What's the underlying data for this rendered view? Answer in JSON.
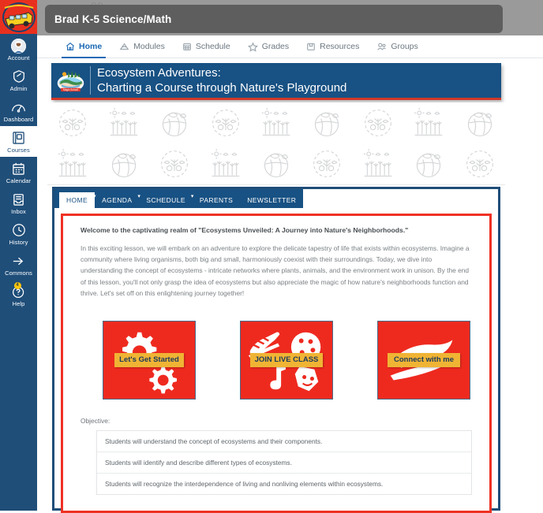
{
  "global_nav": {
    "logo_name": "magic-school-bus-logo",
    "items": [
      {
        "label": "Account",
        "icon": "avatar-icon",
        "active": false,
        "badge": null
      },
      {
        "label": "Admin",
        "icon": "shield-icon",
        "active": false,
        "badge": null
      },
      {
        "label": "Dashboard",
        "icon": "speedometer-icon",
        "active": false,
        "badge": null
      },
      {
        "label": "Courses",
        "icon": "book-icon",
        "active": true,
        "badge": null
      },
      {
        "label": "Calendar",
        "icon": "calendar-icon",
        "active": false,
        "badge": null
      },
      {
        "label": "Inbox",
        "icon": "inbox-icon",
        "active": false,
        "badge": null
      },
      {
        "label": "History",
        "icon": "clock-icon",
        "active": false,
        "badge": null
      },
      {
        "label": "Commons",
        "icon": "arrow-right-icon",
        "active": false,
        "badge": null
      },
      {
        "label": "Help",
        "icon": "question-icon",
        "active": false,
        "badge": "4"
      }
    ]
  },
  "header": {
    "title": "Brad K-5 Science/Math"
  },
  "course_nav": {
    "tabs": [
      {
        "label": "Home",
        "icon": "home-icon",
        "active": true
      },
      {
        "label": "Modules",
        "icon": "modules-icon",
        "active": false
      },
      {
        "label": "Schedule",
        "icon": "schedule-icon",
        "active": false
      },
      {
        "label": "Grades",
        "icon": "star-icon",
        "active": false
      },
      {
        "label": "Resources",
        "icon": "folder-icon",
        "active": false
      },
      {
        "label": "Groups",
        "icon": "groups-icon",
        "active": false
      }
    ]
  },
  "banner": {
    "logo_name": "magic-school-logo",
    "line1": "Ecosystem Adventures:",
    "line2": "Charting a Course through Nature's Playground",
    "bg_color": "#185183",
    "accent_color": "#D0392B"
  },
  "pattern_band": {
    "icons": [
      "ecosystem-circle-icon",
      "wheat-field-icon",
      "globe-leaf-icon",
      "ecosystem-circle-icon",
      "wheat-field-icon",
      "globe-leaf-icon",
      "ecosystem-circle-icon",
      "wheat-field-icon",
      "globe-leaf-icon"
    ],
    "color": "#d2d4d6"
  },
  "inner_tabs": [
    {
      "label": "HOME",
      "active": true
    },
    {
      "label": "AGENDA",
      "active": false
    },
    {
      "label": "SCHEDULE",
      "active": false
    },
    {
      "label": "PARENTS",
      "active": false
    },
    {
      "label": "NEWSLETTER",
      "active": false
    }
  ],
  "lesson": {
    "heading": "Welcome to the captivating realm of \"Ecosystems Unveiled: A Journey into Nature's Neighborhoods.\"",
    "paragraph": "In this exciting lesson, we will embark on an adventure to explore the delicate tapestry of life that exists within ecosystems. Imagine a community where living organisms, both big and small, harmoniously coexist with their surroundings. Today, we dive into understanding the concept of ecosystems - intricate networks where plants, animals, and the environment work in unison. By the end of this lesson, you'll not only grasp the idea of ecosystems but also appreciate the magic of how nature's neighborhoods function and thrive. Let's set off on this enlightening journey together!"
  },
  "action_cards": [
    {
      "label": "Let's Get Started",
      "art": "gears-icon",
      "bg": "#EE2A1F",
      "label_bg": "#F0B434"
    },
    {
      "label": "JOIN LIVE CLASS",
      "art": "activities-icon",
      "bg": "#EE2A1F",
      "label_bg": "#F0B434"
    },
    {
      "label": "Connect with me",
      "art": "brush-stroke-icon",
      "bg": "#EE2A1F",
      "label_bg": "#F0B434"
    }
  ],
  "objective": {
    "title": "Objective:",
    "items": [
      "Students will understand the concept of ecosystems and their components.",
      "Students will identify and describe different types of ecosystems.",
      "Students will recognize the interdependence of living and nonliving elements within ecosystems."
    ]
  }
}
